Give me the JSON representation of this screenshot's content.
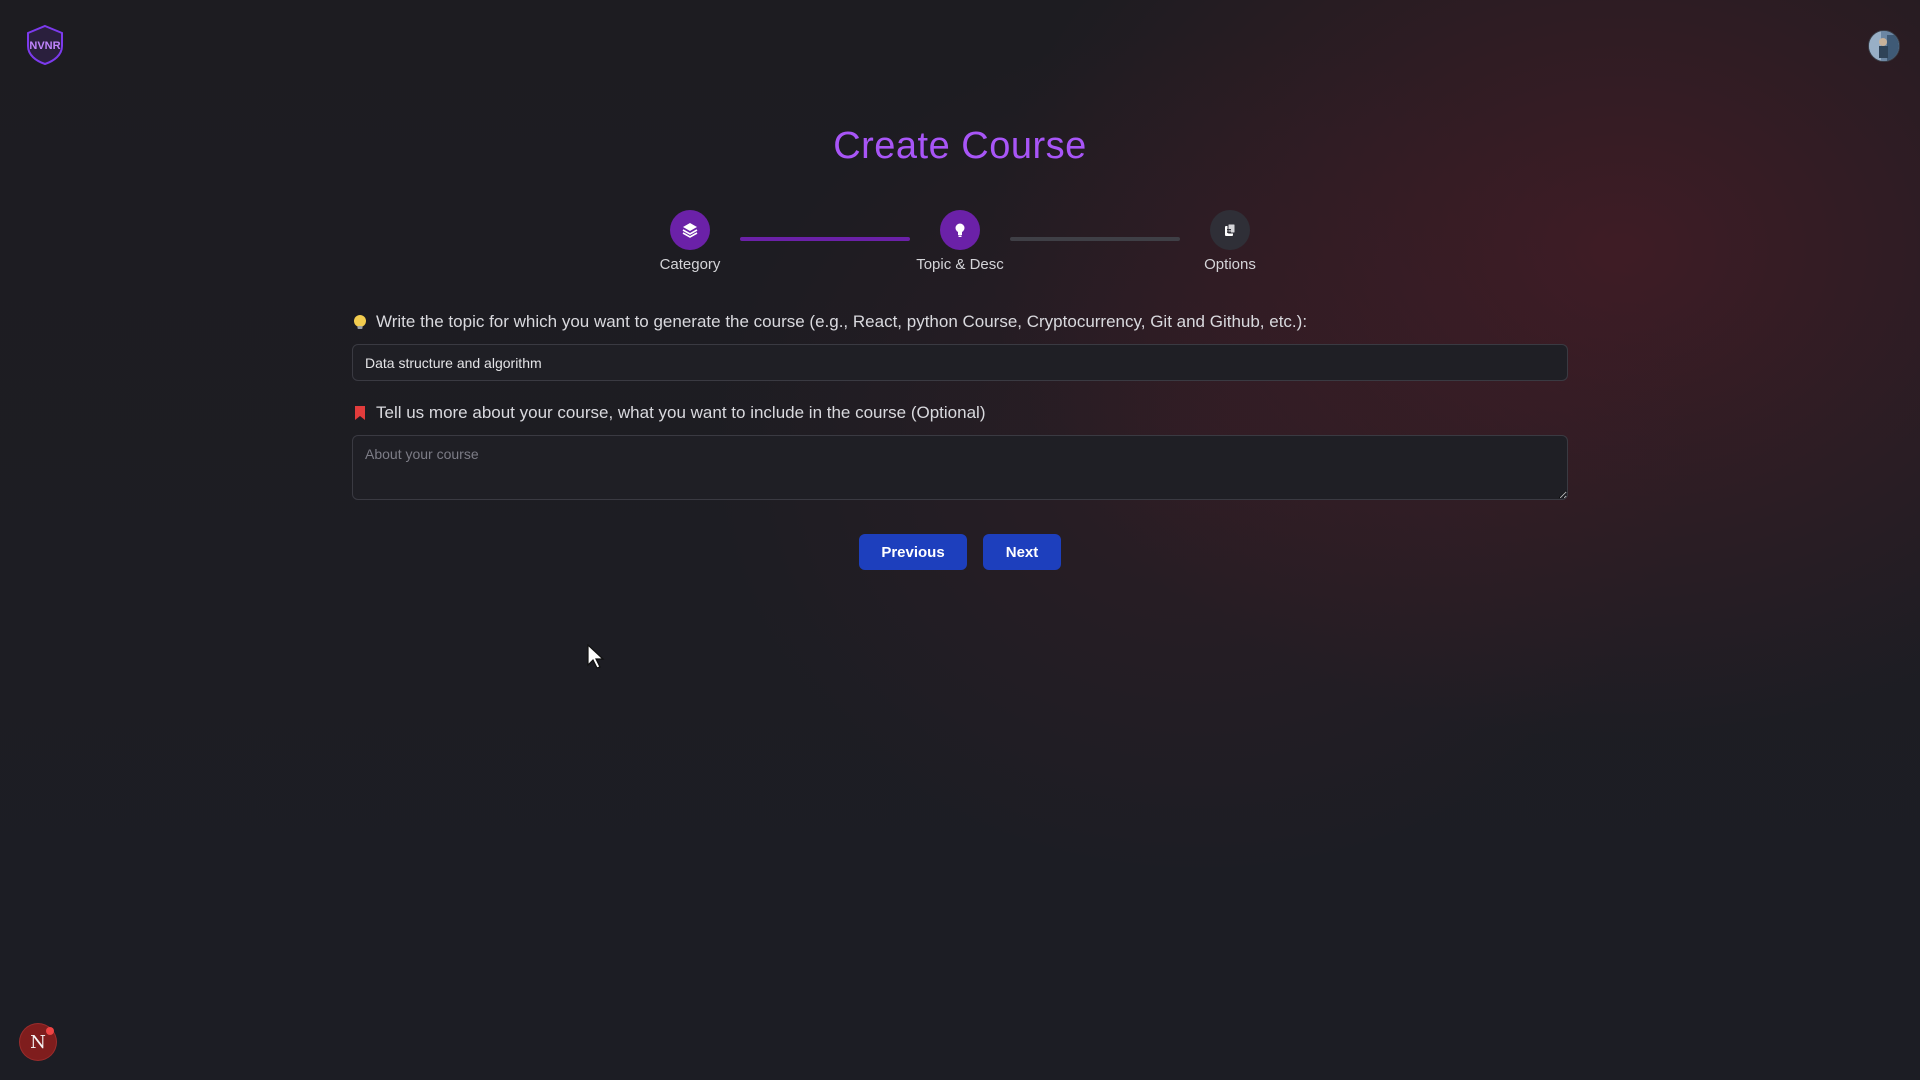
{
  "header": {
    "logo_text": "NVNR",
    "avatar_icon": "user-avatar"
  },
  "page": {
    "title": "Create Course"
  },
  "stepper": {
    "steps": [
      {
        "label": "Category",
        "icon": "layers-icon",
        "state": "complete"
      },
      {
        "label": "Topic & Desc",
        "icon": "lightbulb-icon",
        "state": "active"
      },
      {
        "label": "Options",
        "icon": "clipboard-icon",
        "state": "pending"
      }
    ]
  },
  "form": {
    "topic": {
      "label": "Write the topic for which you want to generate the course (e.g., React, python Course, Cryptocurrency, Git and Github, etc.):",
      "icon": "lightbulb-emoji-icon",
      "value": "Data structure and algorithm"
    },
    "description": {
      "label": "Tell us more about your course, what you want to include in the course (Optional)",
      "icon": "bookmark-icon",
      "placeholder": "About your course",
      "value": ""
    }
  },
  "actions": {
    "previous_label": "Previous",
    "next_label": "Next"
  },
  "colors": {
    "accent": "#a855f7",
    "step_active": "#6b21a8",
    "button": "#1d3fbd"
  },
  "dev_badge": {
    "letter": "N"
  }
}
